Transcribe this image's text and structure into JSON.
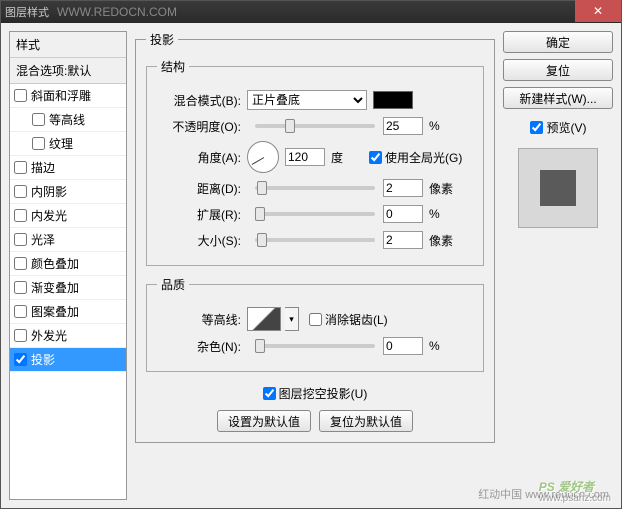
{
  "window": {
    "title": "图层样式",
    "watermark": "WWW.REDOCN.COM",
    "close": "✕"
  },
  "sidebar": {
    "header": "样式",
    "subheader": "混合选项:默认",
    "items": [
      {
        "label": "斜面和浮雕",
        "checked": false,
        "selected": false
      },
      {
        "label": "等高线",
        "checked": false,
        "selected": false,
        "indent": true
      },
      {
        "label": "纹理",
        "checked": false,
        "selected": false,
        "indent": true
      },
      {
        "label": "描边",
        "checked": false,
        "selected": false
      },
      {
        "label": "内阴影",
        "checked": false,
        "selected": false
      },
      {
        "label": "内发光",
        "checked": false,
        "selected": false
      },
      {
        "label": "光泽",
        "checked": false,
        "selected": false
      },
      {
        "label": "颜色叠加",
        "checked": false,
        "selected": false
      },
      {
        "label": "渐变叠加",
        "checked": false,
        "selected": false
      },
      {
        "label": "图案叠加",
        "checked": false,
        "selected": false
      },
      {
        "label": "外发光",
        "checked": false,
        "selected": false
      },
      {
        "label": "投影",
        "checked": true,
        "selected": true
      }
    ]
  },
  "main": {
    "group_title": "投影",
    "structure": {
      "legend": "结构",
      "blend_mode_label": "混合模式(B):",
      "blend_mode_value": "正片叠底",
      "color": "#000000",
      "opacity_label": "不透明度(O):",
      "opacity_value": "25",
      "opacity_unit": "%",
      "angle_label": "角度(A):",
      "angle_value": "120",
      "angle_unit": "度",
      "global_light_label": "使用全局光(G)",
      "global_light_checked": true,
      "distance_label": "距离(D):",
      "distance_value": "2",
      "distance_unit": "像素",
      "spread_label": "扩展(R):",
      "spread_value": "0",
      "spread_unit": "%",
      "size_label": "大小(S):",
      "size_value": "2",
      "size_unit": "像素"
    },
    "quality": {
      "legend": "品质",
      "contour_label": "等高线:",
      "antialias_label": "消除锯齿(L)",
      "antialias_checked": false,
      "noise_label": "杂色(N):",
      "noise_value": "0",
      "noise_unit": "%"
    },
    "knockout_label": "图层挖空投影(U)",
    "knockout_checked": true,
    "btn_default": "设置为默认值",
    "btn_reset": "复位为默认值"
  },
  "right": {
    "ok": "确定",
    "cancel": "复位",
    "new_style": "新建样式(W)...",
    "preview_label": "预览(V)",
    "preview_checked": true
  },
  "footer": {
    "wm1": "红动中国 www.redocn.com",
    "wm2": "PS 爱好者",
    "wm3": "www.psahz.com"
  }
}
